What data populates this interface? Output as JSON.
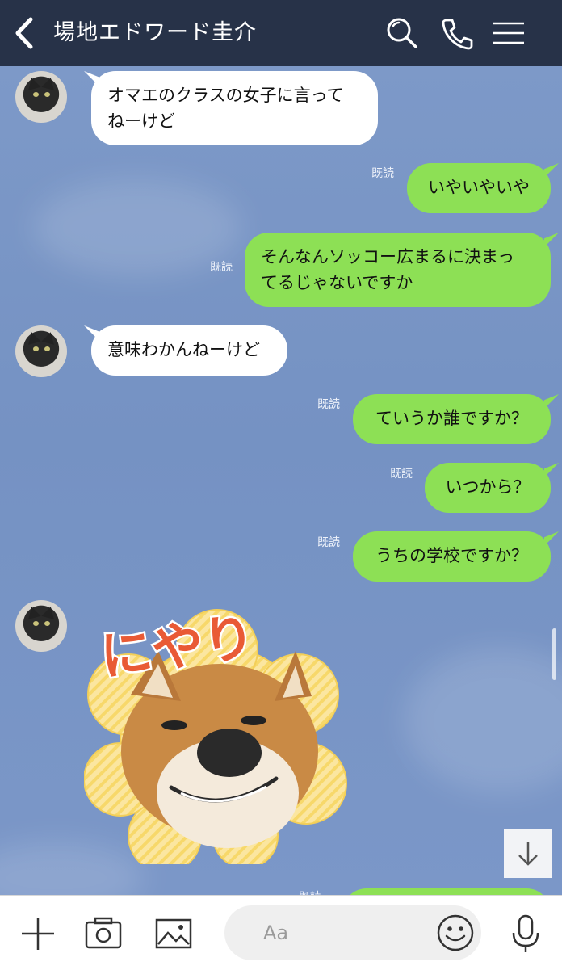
{
  "header": {
    "title": "場地エドワード圭介",
    "icons": [
      "back-arrow-icon",
      "search-icon",
      "phone-icon",
      "menu-icon"
    ]
  },
  "messages": [
    {
      "side": "in",
      "text_line1": "オマエのクラスの女子に言って",
      "text_line2": "ねーけど"
    },
    {
      "side": "out",
      "read": "既読",
      "text": "いやいやいや"
    },
    {
      "side": "out",
      "read": "既読",
      "text_line1": "そんなんソッコー広まるに決まっ",
      "text_line2": "てるじゃないですか"
    },
    {
      "side": "in",
      "text": "意味わかんねーけど"
    },
    {
      "side": "out",
      "read": "既読",
      "text": "ていうか誰ですか？"
    },
    {
      "side": "out",
      "read": "既読",
      "text": "いつから？"
    },
    {
      "side": "out",
      "read": "既読",
      "text": "うちの学校ですか？"
    },
    {
      "side": "in",
      "sticker_text": "にやり",
      "sticker_icon": "shiba-dog-grin-sticker"
    },
    {
      "side": "out",
      "read": "既読",
      "text": ""
    }
  ],
  "toolbar": {
    "input_placeholder": "Aa",
    "icons": [
      "plus-icon",
      "camera-icon",
      "image-icon",
      "emoji-icon",
      "microphone-icon"
    ]
  },
  "colors": {
    "header_bg": "#273248",
    "chat_bg": "#7a95c4",
    "outgoing_bubble": "#8de055",
    "incoming_bubble": "#ffffff"
  }
}
